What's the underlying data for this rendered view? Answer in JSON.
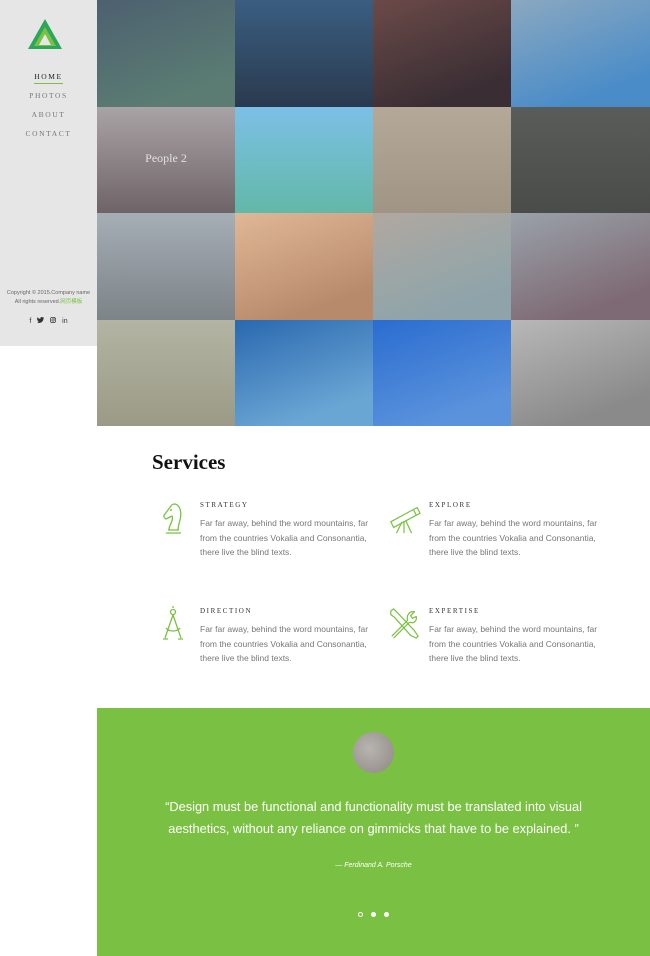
{
  "sidebar": {
    "nav": [
      {
        "label": "HOME",
        "active": true
      },
      {
        "label": "PHOTOS",
        "active": false
      },
      {
        "label": "ABOUT",
        "active": false
      },
      {
        "label": "CONTACT",
        "active": false
      }
    ],
    "copyright_line1": "Copyright © 2015.Company name",
    "copyright_line2": "All rights reserved.",
    "copyright_link": "网页模板",
    "social": [
      "f",
      "t",
      "i",
      "in"
    ]
  },
  "gallery": {
    "caption": "People 2"
  },
  "services": {
    "title": "Services",
    "items": [
      {
        "title": "STRATEGY",
        "icon": "chess-knight-icon",
        "text": "Far far away, behind the word mountains, far from the countries Vokalia and Consonantia, there live the blind texts."
      },
      {
        "title": "EXPLORE",
        "icon": "telescope-icon",
        "text": "Far far away, behind the word mountains, far from the countries Vokalia and Consonantia, there live the blind texts."
      },
      {
        "title": "DIRECTION",
        "icon": "compass-icon",
        "text": "Far far away, behind the word mountains, far from the countries Vokalia and Consonantia, there live the blind texts."
      },
      {
        "title": "EXPERTISE",
        "icon": "tools-icon",
        "text": "Far far away, behind the word mountains, far from the countries Vokalia and Consonantia, there live the blind texts."
      }
    ]
  },
  "testimonial": {
    "quote": "“Design must be functional and functionality must be translated into visual aesthetics, without any reliance on gimmicks that have to be explained. ”",
    "author": "— Ferdinand A. Porsche"
  },
  "colors": {
    "accent": "#7ac143",
    "sidebar_bg": "#e6e6e6"
  }
}
